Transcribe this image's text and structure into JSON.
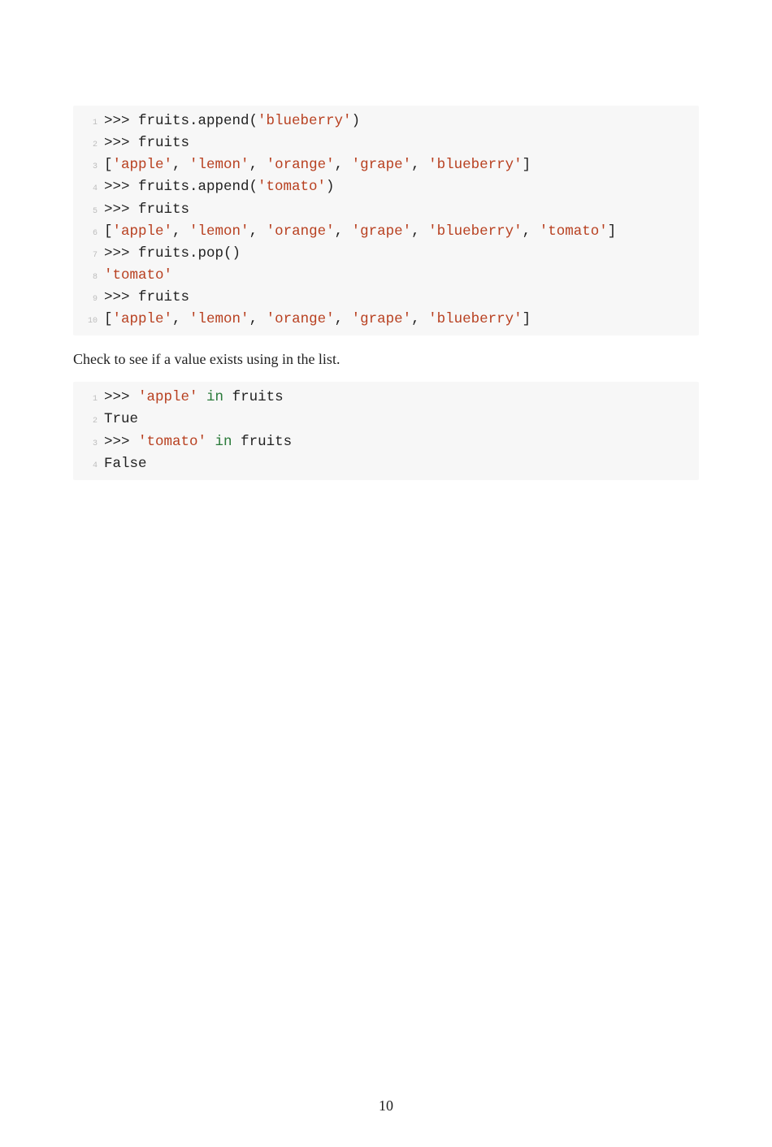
{
  "code1": {
    "lines": [
      {
        "n": "1",
        "tokens": [
          ">>> fruits.append(",
          {
            "s": "'blueberry'"
          },
          ")"
        ]
      },
      {
        "n": "2",
        "tokens": [
          ">>> fruits"
        ]
      },
      {
        "n": "3",
        "tokens": [
          "[",
          {
            "s": "'apple'"
          },
          ", ",
          {
            "s": "'lemon'"
          },
          ", ",
          {
            "s": "'orange'"
          },
          ", ",
          {
            "s": "'grape'"
          },
          ", ",
          {
            "s": "'blueberry'"
          },
          "]"
        ]
      },
      {
        "n": "4",
        "tokens": [
          ">>> fruits.append(",
          {
            "s": "'tomato'"
          },
          ")"
        ]
      },
      {
        "n": "5",
        "tokens": [
          ">>> fruits"
        ]
      },
      {
        "n": "6",
        "tokens": [
          "[",
          {
            "s": "'apple'"
          },
          ", ",
          {
            "s": "'lemon'"
          },
          ", ",
          {
            "s": "'orange'"
          },
          ", ",
          {
            "s": "'grape'"
          },
          ", ",
          {
            "s": "'blueberry'"
          },
          ", ",
          {
            "s": "'tomato'"
          },
          "]"
        ]
      },
      {
        "n": "7",
        "tokens": [
          ">>> fruits.pop()"
        ]
      },
      {
        "n": "8",
        "tokens": [
          {
            "s": "'tomato'"
          }
        ]
      },
      {
        "n": "9",
        "tokens": [
          ">>> fruits"
        ]
      },
      {
        "n": "10",
        "tokens": [
          "[",
          {
            "s": "'apple'"
          },
          ", ",
          {
            "s": "'lemon'"
          },
          ", ",
          {
            "s": "'orange'"
          },
          ", ",
          {
            "s": "'grape'"
          },
          ", ",
          {
            "s": "'blueberry'"
          },
          "]"
        ]
      }
    ]
  },
  "prose1": "Check to see if a value exists using in the list.",
  "code2": {
    "lines": [
      {
        "n": "1",
        "tokens": [
          ">>> ",
          {
            "s": "'apple'"
          },
          " ",
          {
            "k": "in"
          },
          " fruits"
        ]
      },
      {
        "n": "2",
        "tokens": [
          "True"
        ]
      },
      {
        "n": "3",
        "tokens": [
          ">>> ",
          {
            "s": "'tomato'"
          },
          " ",
          {
            "k": "in"
          },
          " fruits"
        ]
      },
      {
        "n": "4",
        "tokens": [
          "False"
        ]
      }
    ]
  },
  "page_number": "10"
}
